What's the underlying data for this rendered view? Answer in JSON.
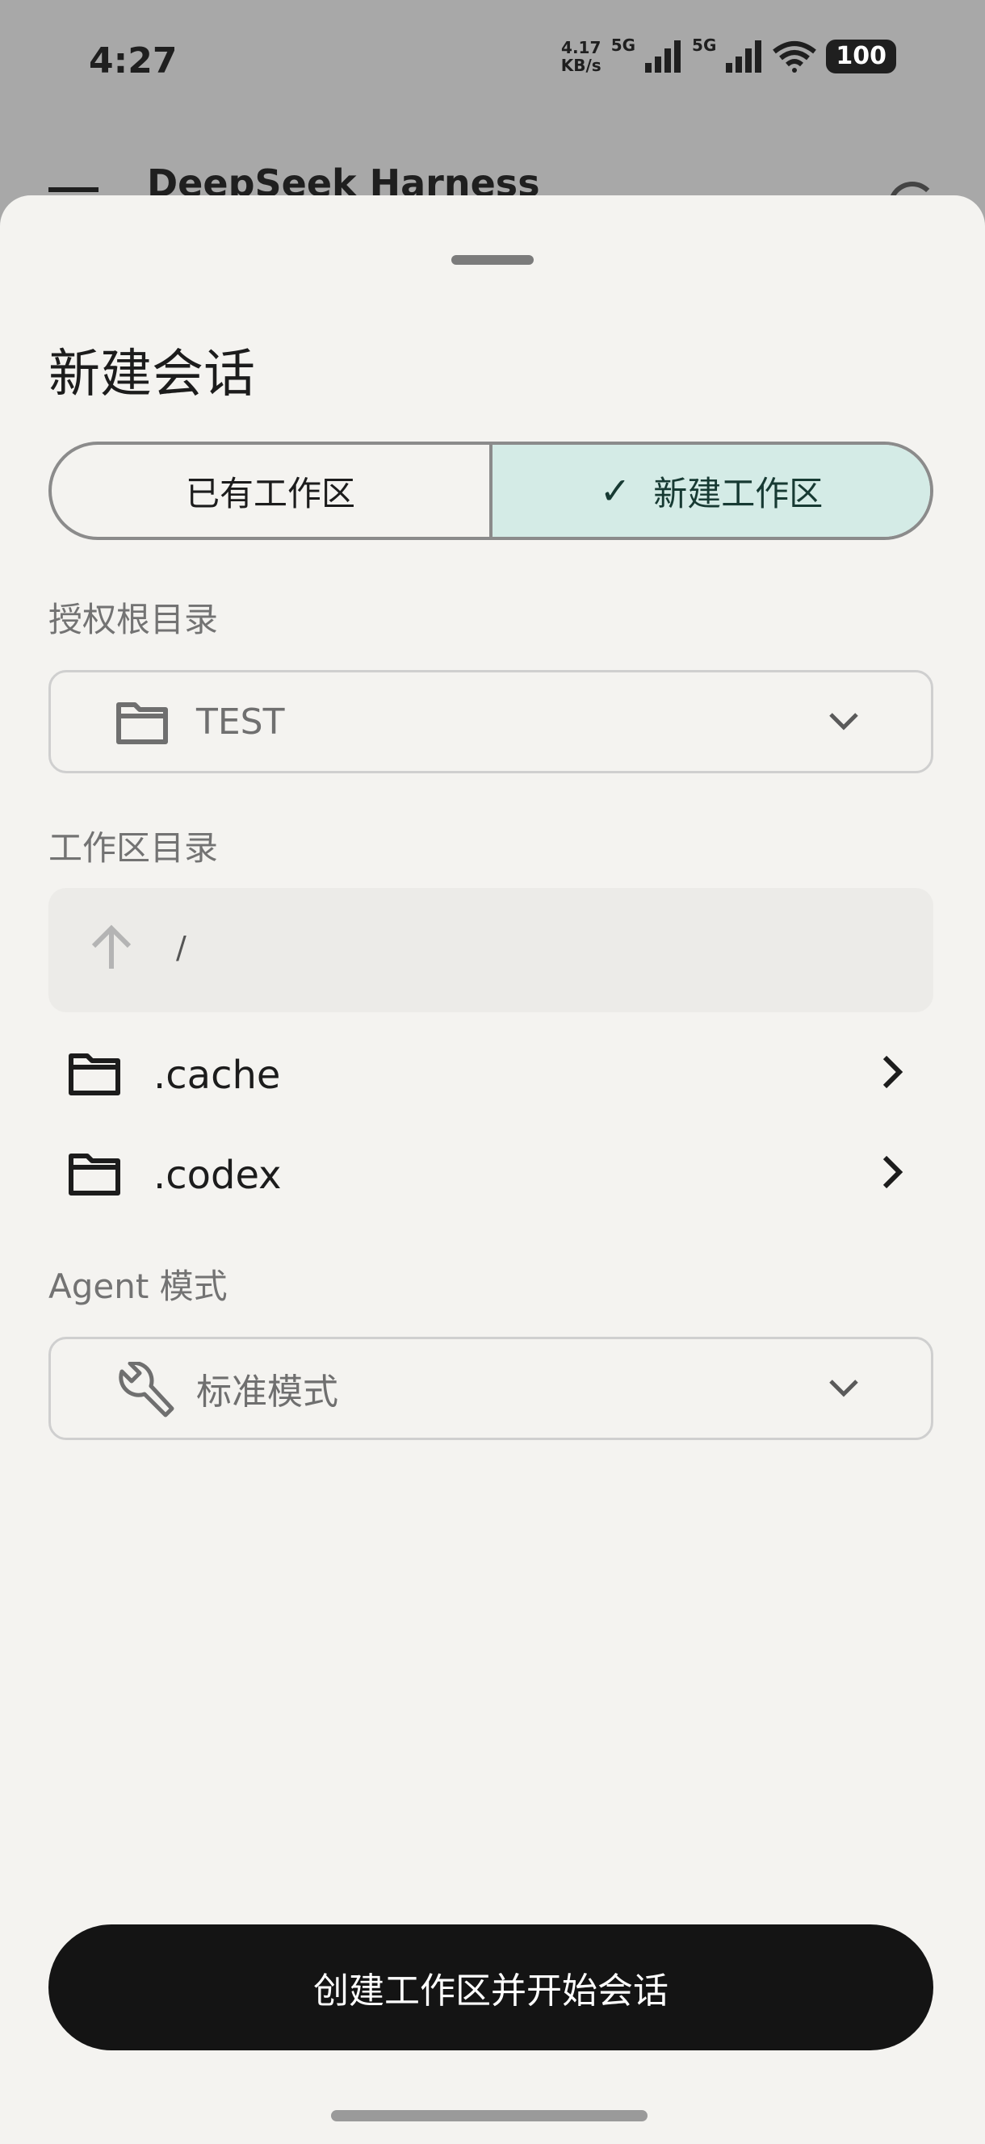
{
  "status_bar": {
    "time": "4:27",
    "speed_value": "4.17",
    "speed_unit": "KB/s",
    "network_1": "5G",
    "network_2": "5G",
    "battery": "100"
  },
  "app_bar": {
    "title": "DeepSeek Harness"
  },
  "sheet": {
    "title": "新建会话",
    "segments": [
      {
        "label": "已有工作区",
        "selected": false
      },
      {
        "label": "新建工作区",
        "selected": true
      }
    ],
    "root_dir": {
      "label": "授权根目录",
      "value": "TEST",
      "icon": "folder-icon"
    },
    "workspace_dir": {
      "label": "工作区目录",
      "current_path": "/",
      "folders": [
        {
          "name": ".cache"
        },
        {
          "name": ".codex"
        }
      ]
    },
    "agent_mode": {
      "label": "Agent 模式",
      "value": "标准模式",
      "icon": "wrench-icon"
    },
    "create_button": "创建工作区并开始会话"
  },
  "colors": {
    "accent_selected_bg": "#d4ebe6",
    "primary_button_bg": "#141414",
    "sheet_bg": "#f4f3f0"
  }
}
